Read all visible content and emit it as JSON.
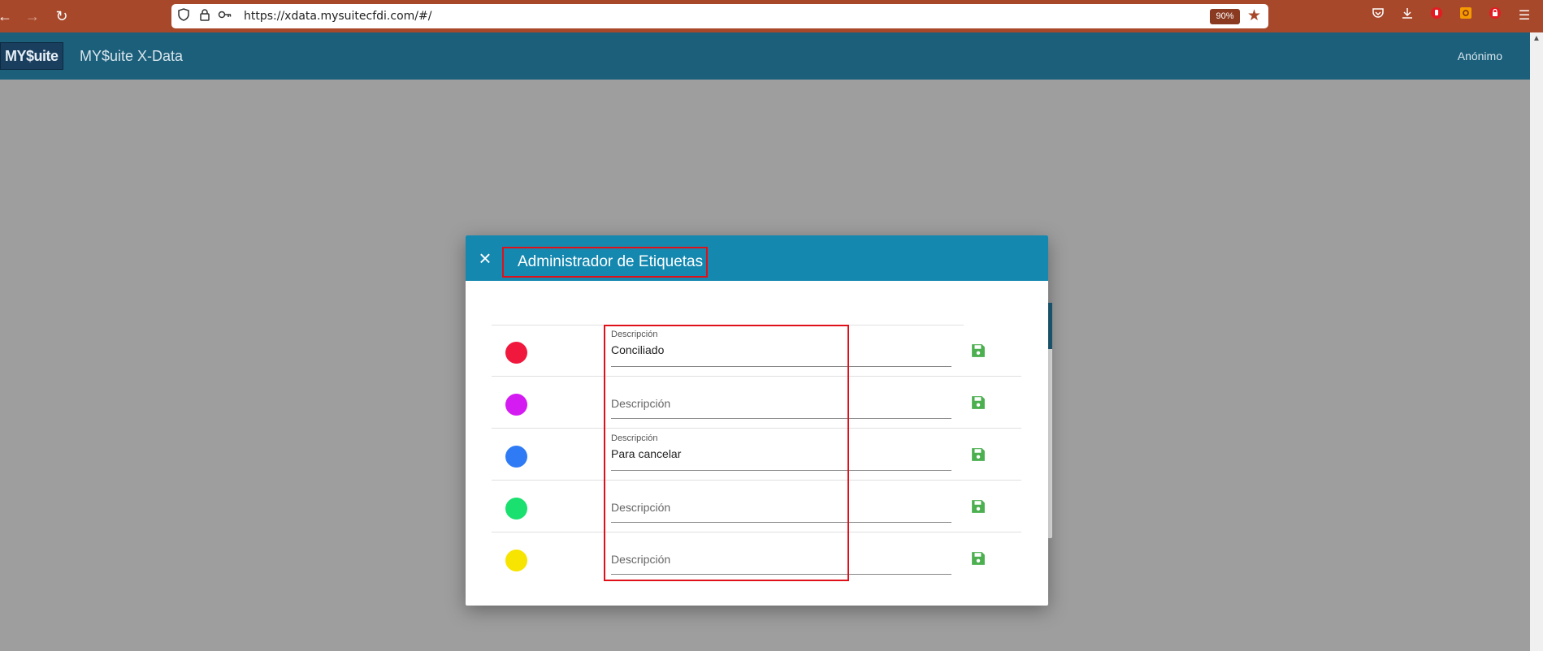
{
  "browser": {
    "url": "https://xdata.mysuitecfdi.com/#/",
    "zoom": "90%",
    "back_icon": "arrow-left-icon",
    "forward_icon": "arrow-right-icon",
    "reload_icon": "reload-icon"
  },
  "app": {
    "logo_text": "MY$uite",
    "title": "MY$uite X-Data",
    "user": "Anónimo"
  },
  "dialog": {
    "title": "Administrador de Etiquetas",
    "close_icon": "close-icon",
    "rows": [
      {
        "color": "#f0183c",
        "label": "Descripción",
        "value": "Conciliado",
        "placeholder": ""
      },
      {
        "color": "#d41cf2",
        "label": "",
        "value": "",
        "placeholder": "Descripción"
      },
      {
        "color": "#2f7bf5",
        "label": "Descripción",
        "value": "Para cancelar",
        "placeholder": ""
      },
      {
        "color": "#19e06e",
        "label": "",
        "value": "",
        "placeholder": "Descripción"
      },
      {
        "color": "#f7e400",
        "label": "",
        "value": "",
        "placeholder": "Descripción"
      }
    ],
    "save_icon_color": "#4caf50"
  },
  "highlight_color": "#e0101a"
}
